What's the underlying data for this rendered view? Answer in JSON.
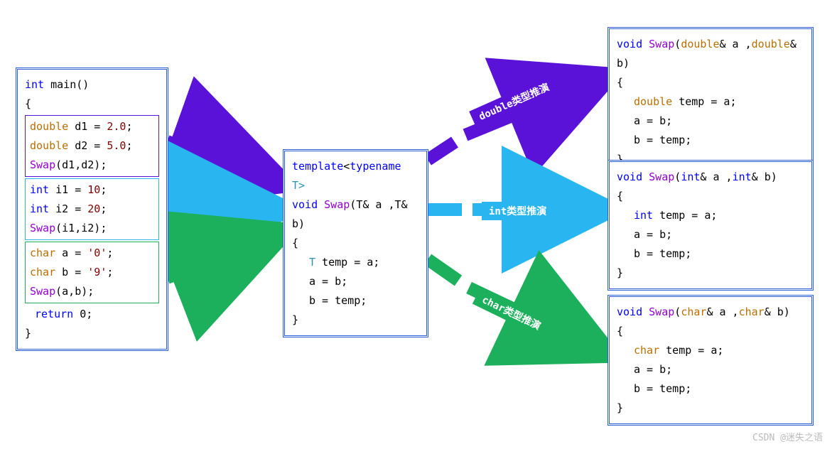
{
  "main": {
    "sig_kw": "int",
    "sig_name": "main",
    "sig_parens": "()",
    "open": "{",
    "close": "}",
    "block_double": {
      "l1_kw": "double",
      "l1_rest": " d1 = ",
      "l1_num": "2.0",
      "l1_semi": ";",
      "l2_kw": "double",
      "l2_rest": " d2 = ",
      "l2_num": "5.0",
      "l2_semi": ";",
      "l3_fn": "Swap",
      "l3_args": "(d1,d2);"
    },
    "block_int": {
      "l1_kw": "int",
      "l1_rest": " i1 = ",
      "l1_num": "10",
      "l1_semi": ";",
      "l2_kw": "int",
      "l2_rest": " i2 = ",
      "l2_num": "20",
      "l2_semi": ";",
      "l3_fn": "Swap",
      "l3_args": "(i1,i2);"
    },
    "block_char": {
      "l1_kw": "char",
      "l1_rest": " a = ",
      "l1_num": "'0'",
      "l1_semi": ";",
      "l2_kw": "char",
      "l2_rest": " b = ",
      "l2_num": "'9'",
      "l2_semi": ";",
      "l3_fn": "Swap",
      "l3_args": "(a,b);"
    },
    "ret_kw": "return",
    "ret_val": " 0;",
    "colors": {
      "double": "#5a12d8",
      "int": "#29b6f0",
      "char": "#1cb05c"
    }
  },
  "template": {
    "l1a": "template",
    "l1b": "<",
    "l1c": "typename",
    "l1d": " T>",
    "l2a": "void",
    "l2b": " Swap",
    "l2c": "(T& a ,T& b)",
    "open": "{",
    "l3a": "T",
    "l3b": " temp = a;",
    "l4": "a = b;",
    "l5": "b = temp;",
    "close": "}"
  },
  "deduced": {
    "double": {
      "l1a": "void",
      "l1b": " Swap",
      "l1c_pre": "(",
      "l1c_t": "double",
      "l1c_mid": "& a ,",
      "l1c_t2": "double",
      "l1c_end": "& b)",
      "open": "{",
      "l2a": "double",
      "l2b": " temp = a;",
      "l3": "a = b;",
      "l4": "b = temp;",
      "close": "}"
    },
    "int": {
      "l1a": "void",
      "l1b": " Swap",
      "l1c_pre": "(",
      "l1c_t": "int",
      "l1c_mid": "& a ,",
      "l1c_t2": "int",
      "l1c_end": "& b)",
      "open": "{",
      "l2a": "int",
      "l2b": " temp = a;",
      "l3": "a = b;",
      "l4": "b = temp;",
      "close": "}"
    },
    "char": {
      "l1a": "void",
      "l1b": " Swap",
      "l1c_pre": "(",
      "l1c_t": "char",
      "l1c_mid": "& a ,",
      "l1c_t2": "char",
      "l1c_end": "& b)",
      "open": "{",
      "l2a": "char",
      "l2b": " temp = a;",
      "l3": "a = b;",
      "l4": "b = temp;",
      "close": "}"
    }
  },
  "labels": {
    "double": "double类型推演",
    "int": "int类型推演",
    "char": "char类型推演"
  },
  "watermark": "CSDN @迷失之语"
}
